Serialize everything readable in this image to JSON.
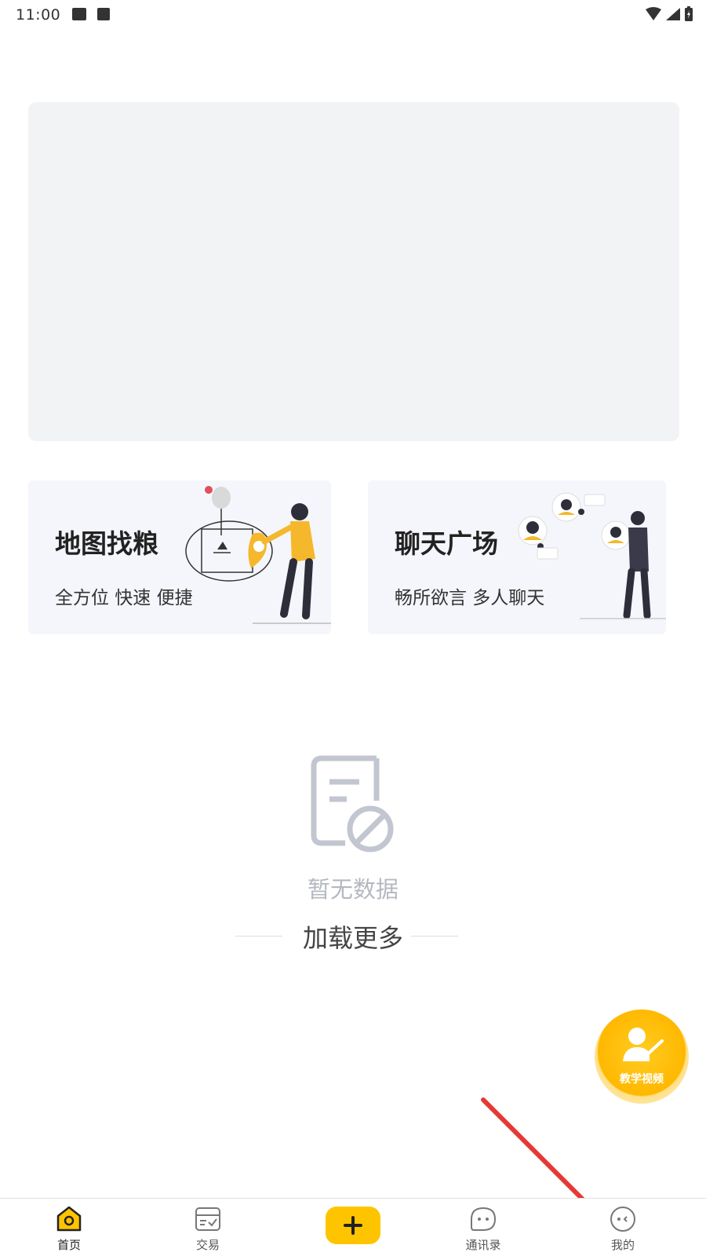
{
  "status_bar": {
    "time": "11:00"
  },
  "cards": [
    {
      "title": "地图找粮",
      "subtitle": "全方位 快速 便捷"
    },
    {
      "title": "聊天广场",
      "subtitle": "畅所欲言 多人聊天"
    }
  ],
  "empty_state": {
    "text": "暂无数据"
  },
  "load_more": {
    "label": "加载更多"
  },
  "fab": {
    "label": "教学视频"
  },
  "tabbar": {
    "items": [
      {
        "label": "首页",
        "icon": "home-icon",
        "active": true
      },
      {
        "label": "交易",
        "icon": "trade-icon",
        "active": false
      },
      {
        "label": "",
        "icon": "plus-icon",
        "active": false
      },
      {
        "label": "通讯录",
        "icon": "contacts-icon",
        "active": false
      },
      {
        "label": "我的",
        "icon": "profile-icon",
        "active": false
      }
    ]
  },
  "colors": {
    "accent": "#ffc400",
    "banner_bg": "#f2f3f5",
    "card_bg": "#f5f6fb",
    "annotation_arrow": "#e53935"
  }
}
